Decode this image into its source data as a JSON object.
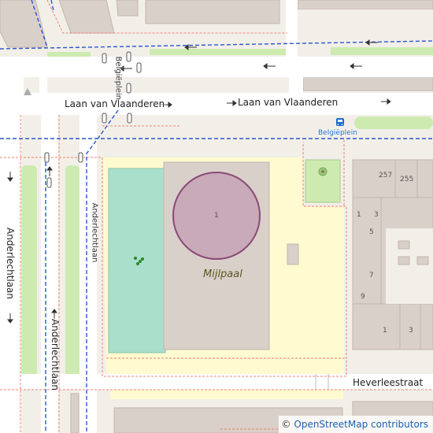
{
  "map": {
    "streets": {
      "laan_west": "Laan van Vlaanderen",
      "laan_east": "Laan van Vlaanderen",
      "anderlechtlaan_west": "Anderlechtlaan",
      "anderlechtlaan_mid": "Anderlechtlaan",
      "anderlechtlaan_east": "Anderlechtlaan",
      "belgieplein_vertical": "Belgiëplein",
      "heverleestraat": "Heverleestraat"
    },
    "bus_stop": "Belgiëplein",
    "place_name": "Mijlpaal",
    "house_numbers": [
      "257",
      "255",
      "1",
      "3",
      "5",
      "7",
      "9",
      "1",
      "3"
    ],
    "building_number": "1",
    "colors": {
      "background": "#f2efe9",
      "road": "#ffffff",
      "building": "#d9d0c9",
      "school_area": "#fffad0",
      "pitch": "#aae0cb",
      "grass": "#cdebb0",
      "storage_tank": "#c8aab8",
      "bus_route": "#2a55d0",
      "footway": "#f08070"
    }
  },
  "attribution": {
    "symbol": "©",
    "text": "OpenStreetMap contributors"
  }
}
